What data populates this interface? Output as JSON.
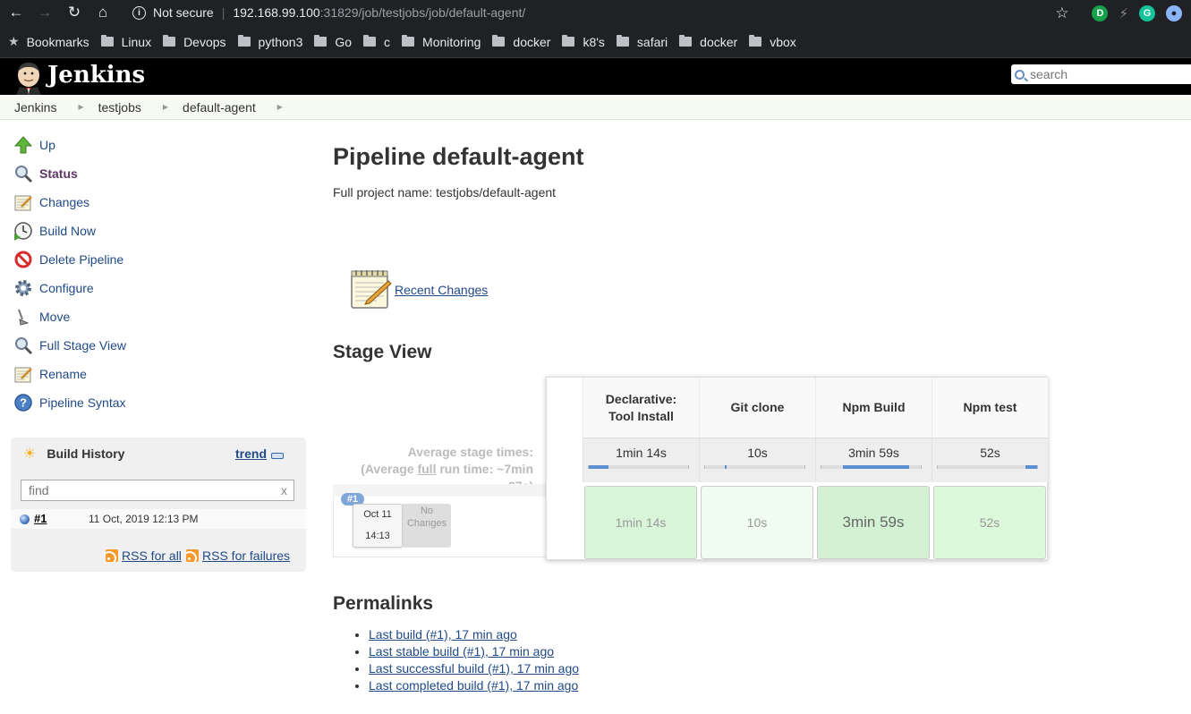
{
  "browser": {
    "security_label": "Not secure",
    "url_host": "192.168.99.100",
    "url_path": ":31829/job/testjobs/job/default-agent/",
    "bookmarks": [
      "Bookmarks",
      "Linux",
      "Devops",
      "python3",
      "Go",
      "c",
      "Monitoring",
      "docker",
      "k8's",
      "safari",
      "docker",
      "vbox"
    ]
  },
  "header": {
    "app_name": "Jenkins",
    "search_placeholder": "search"
  },
  "breadcrumb": [
    "Jenkins",
    "testjobs",
    "default-agent"
  ],
  "sidebar": {
    "tasks": [
      {
        "label": "Up",
        "icon": "up-arrow-icon"
      },
      {
        "label": "Status",
        "icon": "magnifier-icon"
      },
      {
        "label": "Changes",
        "icon": "notepad-icon"
      },
      {
        "label": "Build Now",
        "icon": "clock-play-icon"
      },
      {
        "label": "Delete Pipeline",
        "icon": "no-entry-icon"
      },
      {
        "label": "Configure",
        "icon": "gear-icon"
      },
      {
        "label": "Move",
        "icon": "move-icon"
      },
      {
        "label": "Full Stage View",
        "icon": "magnifier-icon"
      },
      {
        "label": "Rename",
        "icon": "notepad-icon"
      },
      {
        "label": "Pipeline Syntax",
        "icon": "help-icon"
      }
    ],
    "build_history": {
      "title": "Build History",
      "trend_label": "trend",
      "find_placeholder": "find",
      "clear_label": "x",
      "builds": [
        {
          "number": "#1",
          "date": "11 Oct, 2019 12:13 PM",
          "status": "success-blue"
        }
      ],
      "rss_all": "RSS for all",
      "rss_failures": "RSS for failures"
    }
  },
  "main": {
    "title": "Pipeline default-agent",
    "full_name": "Full project name: testjobs/default-agent",
    "recent_changes": "Recent Changes",
    "stage_view_heading": "Stage View",
    "avg_line1": "Average stage times:",
    "avg_line2_pre": "(Average ",
    "avg_line2_full": "full",
    "avg_line2_post": " run time: ~7min",
    "avg_line3": "27s)",
    "build": {
      "badge": "#1",
      "date": "Oct 11",
      "time": "14:13",
      "changes": "No Changes"
    },
    "permalinks_heading": "Permalinks",
    "permalinks": [
      "Last build (#1), 17 min ago",
      "Last stable build (#1), 17 min ago",
      "Last successful build (#1), 17 min ago",
      "Last completed build (#1), 17 min ago"
    ]
  },
  "stage_view": {
    "stages": [
      {
        "name_line1": "Declarative:",
        "name_line2": "Tool Install",
        "avg": "1min 14s",
        "run": "1min 14s",
        "avg_bar_start": 0.0,
        "avg_bar_fraction": 0.2,
        "cell_color": "#d9f5d9"
      },
      {
        "name_line1": "Git clone",
        "name_line2": "",
        "avg": "10s",
        "run": "10s",
        "avg_bar_start": 0.2,
        "avg_bar_fraction": 0.02,
        "cell_color": "#effcef"
      },
      {
        "name_line1": "Npm Build",
        "name_line2": "",
        "avg": "3min 59s",
        "run": "3min 59s",
        "avg_bar_start": 0.22,
        "avg_bar_fraction": 0.66,
        "cell_color": "#d3f2d3"
      },
      {
        "name_line1": "Npm test",
        "name_line2": "",
        "avg": "52s",
        "run": "52s",
        "avg_bar_start": 0.88,
        "avg_bar_fraction": 0.12,
        "cell_color": "#dcf9dc"
      }
    ]
  },
  "colors": {
    "link": "#204a87",
    "success_cell": "#d9f5d9",
    "header_bg": "#000000"
  }
}
